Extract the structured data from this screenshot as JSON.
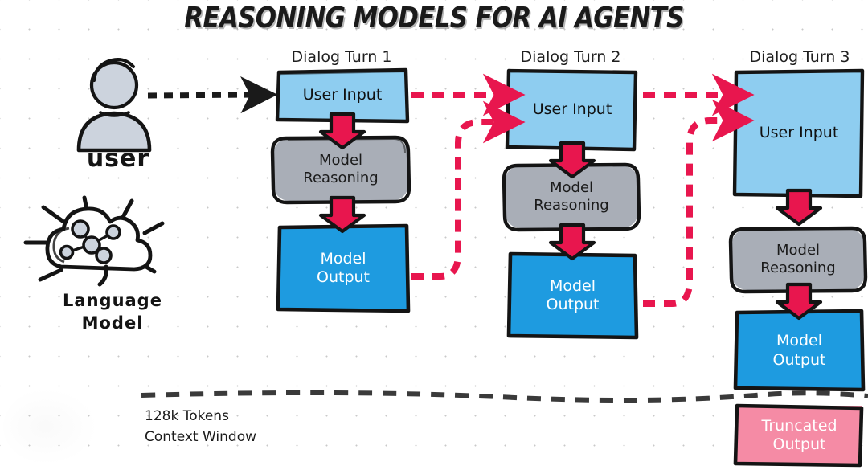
{
  "title": "REASONING MODELS FOR AI AGENTS",
  "colors": {
    "user_input_fill": "#8ecdf0",
    "model_reasoning_fill": "#a9aeb7",
    "model_output_fill": "#1e9be0",
    "truncated_fill": "#f58ba5",
    "arrow_red": "#e8164e",
    "sketch_stroke": "#141414",
    "person_fill": "#ccd3dd",
    "dash_black": "#1a1a1a"
  },
  "actors": {
    "user": {
      "caption": "user",
      "icon": "person-icon"
    },
    "language_model": {
      "caption_line1": "Language",
      "caption_line2": "Model",
      "icon": "cloud-network-icon"
    }
  },
  "turns": [
    {
      "label": "Dialog Turn 1",
      "nodes": [
        {
          "kind": "input",
          "text": "User Input"
        },
        {
          "kind": "reason",
          "line1": "Model",
          "line2": "Reasoning"
        },
        {
          "kind": "output",
          "line1": "Model",
          "line2": "Output"
        }
      ]
    },
    {
      "label": "Dialog Turn 2",
      "nodes": [
        {
          "kind": "input",
          "text": "User Input"
        },
        {
          "kind": "reason",
          "line1": "Model",
          "line2": "Reasoning"
        },
        {
          "kind": "output",
          "line1": "Model",
          "line2": "Output"
        }
      ]
    },
    {
      "label": "Dialog Turn 3",
      "nodes": [
        {
          "kind": "input",
          "text": "User Input"
        },
        {
          "kind": "reason",
          "line1": "Model",
          "line2": "Reasoning"
        },
        {
          "kind": "output",
          "line1": "Model",
          "line2": "Output"
        },
        {
          "kind": "trunc",
          "line1": "Truncated",
          "line2": "Output"
        }
      ]
    }
  ],
  "context_window": {
    "line1": "128k Tokens",
    "line2": "Context Window"
  }
}
